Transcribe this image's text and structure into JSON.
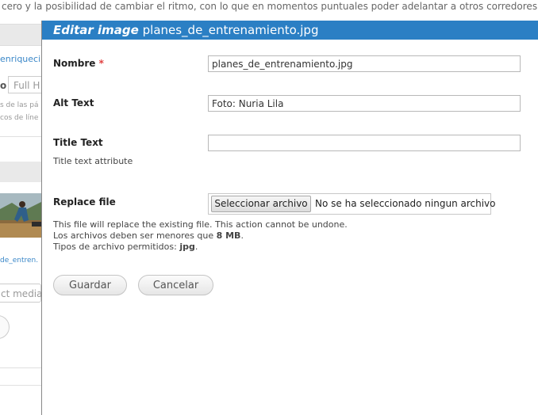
{
  "background": {
    "top_text": "cero y la posibilidad de cambiar el ritmo, con lo que en momentos puntuales poder adelantar a otros corredores o cons",
    "sidebar_link": "enriqueci",
    "option_prefix": "o",
    "option_input": "Full H",
    "small_text_1": "s de las pá",
    "small_text_2": "cos de líne",
    "thumbnail_link": "de_entren.",
    "select_media": "ct media"
  },
  "dialog": {
    "title_prefix": "Editar image",
    "title_filename": "planes_de_entrenamiento.jpg",
    "title_bg": "#2b7fc4",
    "fields": {
      "nombre": {
        "label": "Nombre",
        "required_mark": "*",
        "value": "planes_de_entrenamiento.jpg"
      },
      "alt": {
        "label": "Alt Text",
        "value": "Foto: Nuria Lila"
      },
      "title": {
        "label": "Title Text",
        "value": "",
        "description": "Title text attribute"
      },
      "replace": {
        "label": "Replace file",
        "button": "Seleccionar archivo",
        "status": "No se ha seleccionado ningun archivo",
        "help_1": "This file will replace the existing file. This action cannot be undone.",
        "help_2_prefix": "Los archivos deben ser menores que ",
        "help_2_bold": "8 MB",
        "help_2_suffix": ".",
        "help_3_prefix": "Tipos de archivo permitidos: ",
        "help_3_bold": "jpg",
        "help_3_suffix": "."
      }
    },
    "actions": {
      "save": "Guardar",
      "cancel": "Cancelar"
    }
  }
}
